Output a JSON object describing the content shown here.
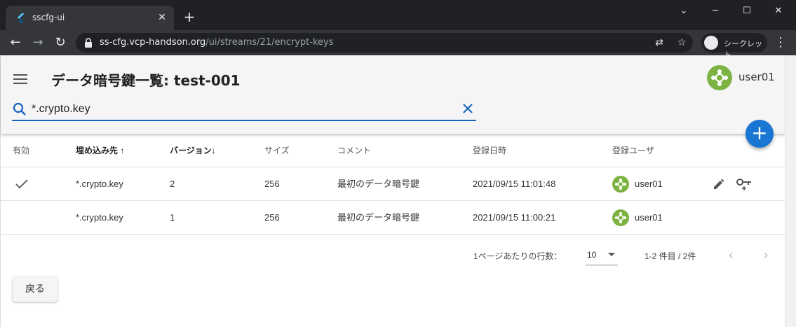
{
  "browser": {
    "tab_title": "sscfg-ui",
    "new_tab": "+",
    "url_host": "ss-cfg.vcp-handson.org",
    "url_path": "/ui/streams/21/encrypt-keys",
    "incognito_label": "シークレット"
  },
  "header": {
    "title": "データ暗号鍵一覧: test-001",
    "user": "user01"
  },
  "search": {
    "value": "*.crypto.key"
  },
  "table": {
    "columns": [
      "有効",
      "埋め込み先 ↑",
      "バージョン↓",
      "サイズ",
      "コメント",
      "登録日時",
      "登録ユーザ"
    ],
    "rows": [
      {
        "active": true,
        "target": "*.crypto.key",
        "version": "2",
        "size": "256",
        "comment": "最初のデータ暗号鍵",
        "registered": "2021/09/15 11:01:48",
        "user": "user01"
      },
      {
        "active": false,
        "target": "*.crypto.key",
        "version": "1",
        "size": "256",
        "comment": "最初のデータ暗号鍵",
        "registered": "2021/09/15 11:00:21",
        "user": "user01"
      }
    ]
  },
  "pagination": {
    "rows_per_page_label": "1ページあたりの行数：",
    "rows_per_page": "10",
    "range": "1-2 件目 / 2件"
  },
  "actions": {
    "back": "戻る",
    "add": "+"
  },
  "colors": {
    "primary": "#1976d2",
    "avatar": "#7cb342"
  }
}
